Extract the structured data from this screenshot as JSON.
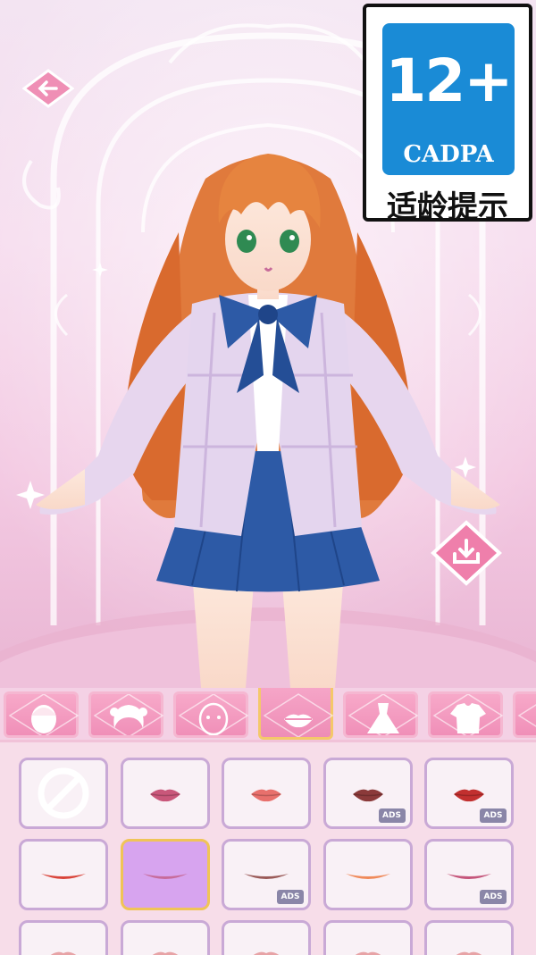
{
  "age_rating": {
    "value": "12+",
    "org": "CADPA",
    "hint": "适龄提示"
  },
  "buttons": {
    "back": "arrow-left-icon",
    "save": "download-icon"
  },
  "tabs": [
    {
      "name": "face-shape",
      "icon": "face-icon",
      "active": false
    },
    {
      "name": "hair",
      "icon": "hair-icon",
      "active": false
    },
    {
      "name": "face-features",
      "icon": "face-detail-icon",
      "active": false
    },
    {
      "name": "lips",
      "icon": "lips-icon",
      "active": true
    },
    {
      "name": "dress",
      "icon": "dress-icon",
      "active": false
    },
    {
      "name": "top",
      "icon": "shirt-icon",
      "active": false
    },
    {
      "name": "more",
      "icon": "more-icon",
      "active": false
    }
  ],
  "options": [
    {
      "kind": "none",
      "color": "",
      "ads": false,
      "selected": false
    },
    {
      "kind": "lips",
      "color": "#c9577a",
      "ads": false,
      "selected": false
    },
    {
      "kind": "lips",
      "color": "#e8706c",
      "ads": false,
      "selected": false
    },
    {
      "kind": "lips",
      "color": "#8b3a3a",
      "ads": true,
      "selected": false
    },
    {
      "kind": "lips",
      "color": "#c2302f",
      "ads": true,
      "selected": false
    },
    {
      "kind": "smile",
      "color": "#d9443a",
      "ads": false,
      "selected": false
    },
    {
      "kind": "smile",
      "color": "#c76b9a",
      "ads": false,
      "selected": true
    },
    {
      "kind": "smile",
      "color": "#9a5a58",
      "ads": true,
      "selected": false
    },
    {
      "kind": "smile",
      "color": "#f08a5a",
      "ads": false,
      "selected": false
    },
    {
      "kind": "smile",
      "color": "#c5567b",
      "ads": true,
      "selected": false
    },
    {
      "kind": "lips",
      "color": "#e7a3a6",
      "ads": false,
      "selected": false
    },
    {
      "kind": "lips",
      "color": "#e7a3a6",
      "ads": false,
      "selected": false
    },
    {
      "kind": "lips",
      "color": "#e7a3a6",
      "ads": false,
      "selected": false
    },
    {
      "kind": "lips",
      "color": "#e7a3a6",
      "ads": false,
      "selected": false
    },
    {
      "kind": "lips",
      "color": "#e7a3a6",
      "ads": false,
      "selected": false
    }
  ],
  "ads_label": "ADS",
  "colors": {
    "accent": "#f08fb8",
    "rating_blue": "#1a8bd6",
    "selected_border": "#f0c457"
  }
}
